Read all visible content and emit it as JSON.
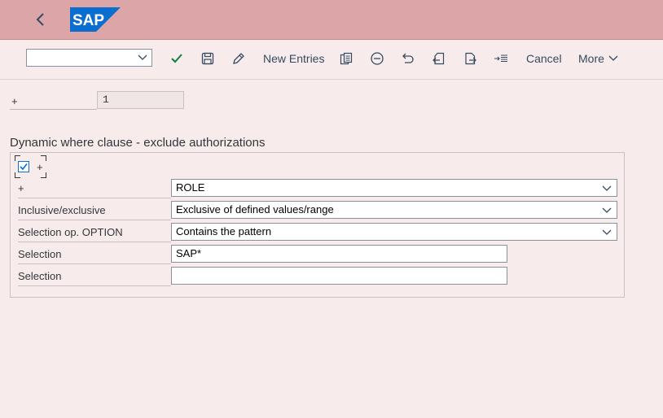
{
  "shell": {
    "logo_text": "SAP"
  },
  "toolbar": {
    "select_value": "",
    "new_entries": "New Entries",
    "cancel": "Cancel",
    "more": "More"
  },
  "header_field": {
    "label": "+",
    "value": "1"
  },
  "section": {
    "title": "Dynamic where clause - exclude authorizations",
    "checkbox_label": "+",
    "checkbox_checked": true,
    "rows": [
      {
        "label": "+",
        "value": "ROLE"
      },
      {
        "label": "Inclusive/exclusive",
        "value": "Exclusive of defined values/range"
      },
      {
        "label": "Selection op. OPTION",
        "value": "Contains the pattern"
      },
      {
        "label": "Selection",
        "value": "SAP*"
      },
      {
        "label": "Selection",
        "value": ""
      }
    ]
  },
  "colors": {
    "shell": "#dca6a8",
    "background": "#f7eceb",
    "accent": "#0a6ed1",
    "check_green": "#107e3e"
  }
}
